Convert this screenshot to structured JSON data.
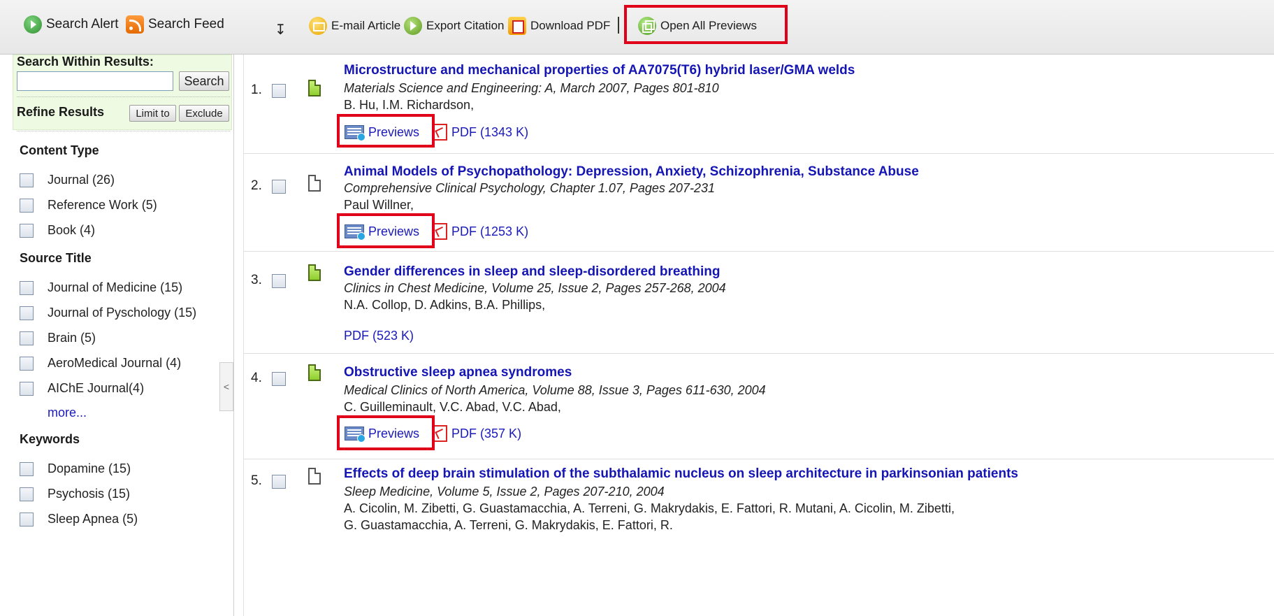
{
  "toolbar": {
    "search_alert": "Search Alert",
    "search_feed": "Search Feed",
    "email_article": "E-mail Article",
    "export_citation": "Export Citation",
    "download_pdf": "Download PDF",
    "separator": "|",
    "open_all_previews": "Open All Previews"
  },
  "sidebar": {
    "search_within_title": "Search Within Results:",
    "search_input_value": "",
    "search_button": "Search",
    "refine_title": "Refine Results",
    "limit_button": "Limit to",
    "exclude_button": "Exclude",
    "content_type": {
      "heading": "Content Type",
      "items": [
        "Journal (26)",
        "Reference Work (5)",
        "Book (4)"
      ]
    },
    "source_title": {
      "heading": "Source Title",
      "items": [
        "Journal of Medicine (15)",
        "Journal of Pyschology (15)",
        "Brain (5)",
        "AeroMedical Journal (4)",
        "AIChE Journal(4)"
      ]
    },
    "more_link": "more...",
    "keywords": {
      "heading": "Keywords",
      "items": [
        "Dopamine (15)",
        "Psychosis (15)",
        "Sleep Apnea (5)"
      ]
    },
    "collapse_glyph": "<"
  },
  "results": [
    {
      "number": "1.",
      "title": "Microstructure and mechanical properties of AA7075(T6) hybrid laser/GMA welds",
      "source": "Materials Science and Engineering: A, March 2007, Pages 801-810",
      "authors": "B. Hu, I.M. Richardson,",
      "previews": "Previews",
      "pdf": "PDF (1343 K)"
    },
    {
      "number": "2.",
      "title": "Animal Models of Psychopathology: Depression, Anxiety, Schizophrenia, Substance Abuse",
      "source": "Comprehensive Clinical Psychology, Chapter 1.07, Pages 207-231",
      "authors": "Paul Willner,",
      "previews": "Previews",
      "pdf": "PDF (1253 K)"
    },
    {
      "number": "3.",
      "title": "Gender differences in sleep and sleep-disordered breathing",
      "source": "Clinics in Chest Medicine, Volume 25, Issue 2, Pages 257-268, 2004",
      "authors": "N.A. Collop, D. Adkins, B.A. Phillips,",
      "pdf": "PDF (523 K)"
    },
    {
      "number": "4.",
      "title": "Obstructive sleep apnea syndromes",
      "source": "Medical Clinics of North America, Volume 88, Issue 3, Pages 611-630, 2004",
      "authors": "C. Guilleminault, V.C. Abad, V.C. Abad,",
      "previews": "Previews",
      "pdf": "PDF (357 K)"
    },
    {
      "number": "5.",
      "title": "Effects of deep brain stimulation of the subthalamic nucleus on sleep architecture in parkinsonian patients",
      "source": "Sleep Medicine, Volume 5, Issue 2, Pages 207-210, 2004",
      "authors": "A. Cicolin, M. Zibetti, G. Guastamacchia, A. Terreni, G. Makrydakis, E. Fattori, R. Mutani, A. Cicolin, M. Zibetti,",
      "authors_line2": "G. Guastamacchia, A. Terreni, G. Makrydakis, E. Fattori, R."
    }
  ],
  "colors": {
    "link": "#1a1ab8",
    "title": "#1515b4",
    "highlight_box": "#e0001a",
    "sidebar_search_bg": "#eefbe2"
  }
}
